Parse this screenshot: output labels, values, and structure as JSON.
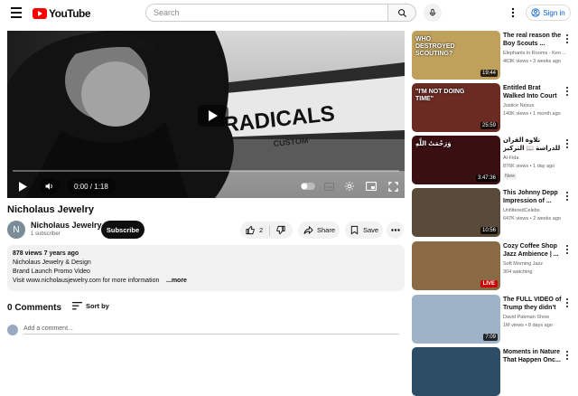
{
  "header": {
    "logo_text": "YouTube",
    "search_placeholder": "Search",
    "signin_label": "Sign in"
  },
  "player": {
    "time": "0:00 / 1:18",
    "progress": 0.0,
    "sign_text": "RADICALS",
    "sign_sub": "CUSTOM"
  },
  "video": {
    "title": "Nicholaus Jewelry",
    "channel": {
      "avatar_letter": "N",
      "name": "Nicholaus Jewelry",
      "subscribers": "1 subscriber"
    },
    "subscribe_label": "Subscribe",
    "likes": "2",
    "share_label": "Share",
    "save_label": "Save",
    "description": {
      "meta": "878 views  7 years ago",
      "lines": [
        "Nicholaus Jewelry & Design",
        "Brand Launch Promo Video",
        "Visit www.nicholausjewelry.com for more information"
      ],
      "more": "...more"
    }
  },
  "comments": {
    "title": "0 Comments",
    "sort_label": "Sort by",
    "add_placeholder": "Add a comment..."
  },
  "recommendations": [
    {
      "title": "The real reason the Boy Scouts ...",
      "channel": "Elephants in Rooms - Ken ...",
      "meta": "463K views • 3 weeks ago",
      "duration": "19:44",
      "thumb_text": "WHO DESTROYED SCOUTING?",
      "thumb_color": "#c0a15c"
    },
    {
      "title": "Entitled Brat Walked Into Court ...",
      "channel": "Justice Nexus",
      "meta": "140K views • 1 month ago",
      "duration": "25:59",
      "thumb_text": "\"I'M NOT DOING TIME\"",
      "thumb_color": "#6b2a22"
    },
    {
      "title": "تلاوة القرآن للدراسة 📖 التركيز راحة",
      "channel": "Al-Fida",
      "meta": "876K views • 1 day ago",
      "duration": "3:47:36",
      "badge": "New",
      "thumb_text": "وَرَحْمَتُ اللَّهِ",
      "thumb_color": "#3a0f12"
    },
    {
      "title": "This Johnny Depp Impression of ...",
      "channel": "UnfilteredCelebs",
      "meta": "647K views • 2 weeks ago",
      "duration": "10:56",
      "thumb_color": "#5a4a3a"
    },
    {
      "title": "Cozy Coffee Shop Jazz Ambience | ...",
      "channel": "Soft Morning Jazz",
      "meta": "304 watching",
      "live_label": "LIVE",
      "thumb_color": "#8a6a44"
    },
    {
      "title": "The FULL VIDEO of Trump they didn't ...",
      "channel": "David Pakman Show",
      "meta": "1M views • 8 days ago",
      "duration": "7:09",
      "thumb_color": "#9fb3c8"
    },
    {
      "title": "Moments in Nature That Happen Onc...",
      "channel": "",
      "meta": "",
      "thumb_color": "#2d4d66"
    }
  ]
}
